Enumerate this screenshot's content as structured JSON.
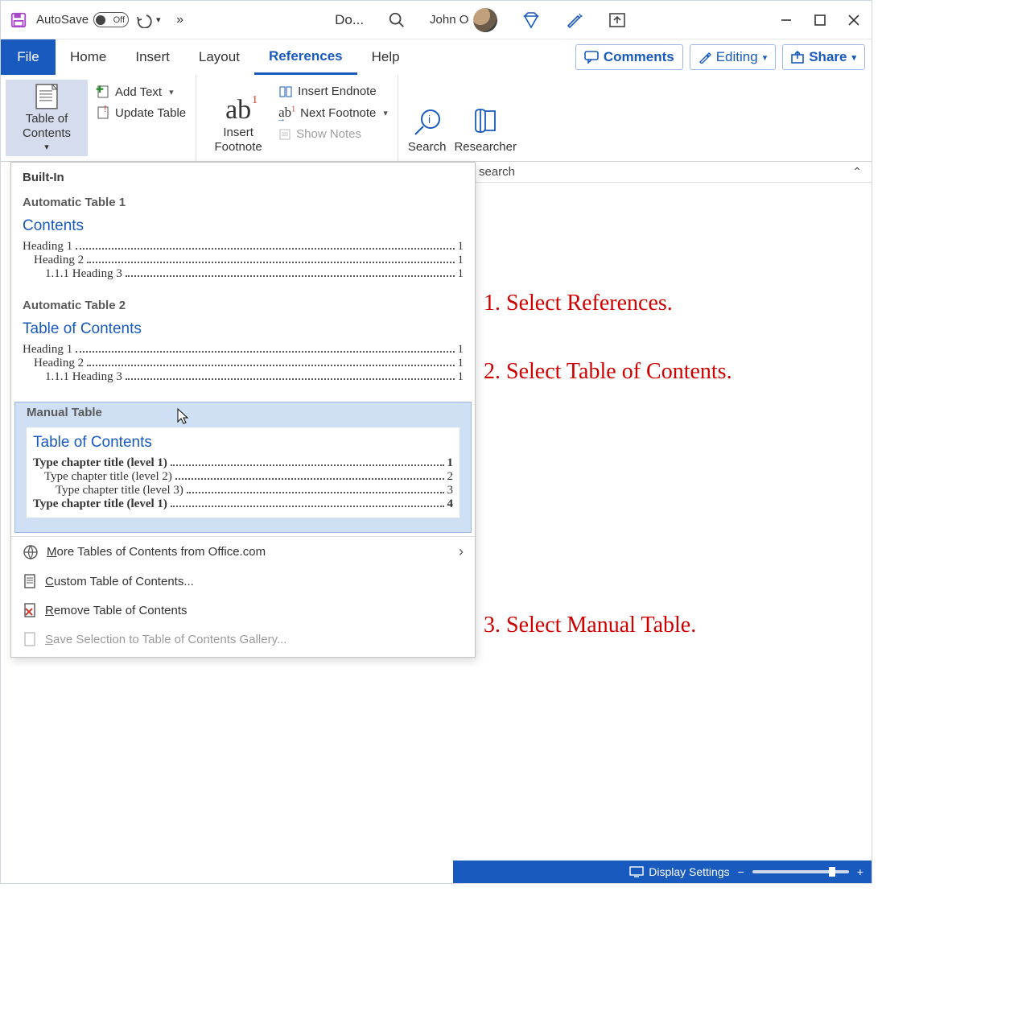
{
  "titlebar": {
    "autosave_label": "AutoSave",
    "autosave_state": "Off",
    "doc_title": "Do...",
    "user_name": "John O"
  },
  "tabs": {
    "file": "File",
    "home": "Home",
    "insert": "Insert",
    "layout": "Layout",
    "references": "References",
    "help": "Help"
  },
  "actions": {
    "comments": "Comments",
    "editing": "Editing",
    "share": "Share"
  },
  "ribbon": {
    "toc": "Table of Contents",
    "add_text": "Add Text",
    "update_table": "Update Table",
    "insert_footnote": "Insert Footnote",
    "insert_endnote": "Insert Endnote",
    "next_footnote": "Next Footnote",
    "show_notes": "Show Notes",
    "search": "Search",
    "researcher": "Researcher"
  },
  "sidepanel": {
    "search_tail": "search"
  },
  "gallery": {
    "built_in": "Built-In",
    "auto1": {
      "title": "Automatic Table 1",
      "heading": "Contents",
      "h1": "Heading 1",
      "p1": "1",
      "h2": "Heading 2",
      "p2": "1",
      "h3": "1.1.1    Heading 3",
      "p3": "1"
    },
    "auto2": {
      "title": "Automatic Table 2",
      "heading": "Table of Contents",
      "h1": "Heading 1",
      "p1": "1",
      "h2": "Heading 2",
      "p2": "1",
      "h3": "1.1.1    Heading 3",
      "p3": "1"
    },
    "manual": {
      "title": "Manual Table",
      "heading": "Table of Contents",
      "l1": "Type chapter title (level 1)",
      "p1": "1",
      "l2": "Type chapter title (level 2)",
      "p2": "2",
      "l3": "Type chapter title (level 3)",
      "p3": "3",
      "l4": "Type chapter title (level 1)",
      "p4": "4"
    },
    "menu": {
      "more_pre": "M",
      "more": "ore Tables of Contents from Office.com",
      "custom_pre": "C",
      "custom": "ustom Table of Contents...",
      "remove_pre": "R",
      "remove": "emove Table of Contents",
      "save_pre": "S",
      "save": "ave Selection to Table of Contents Gallery..."
    }
  },
  "annotations": {
    "a1": "1. Select References.",
    "a2": "2. Select Table of Contents.",
    "a3": "3. Select Manual Table."
  },
  "statusbar": {
    "display_settings": "Display Settings"
  }
}
